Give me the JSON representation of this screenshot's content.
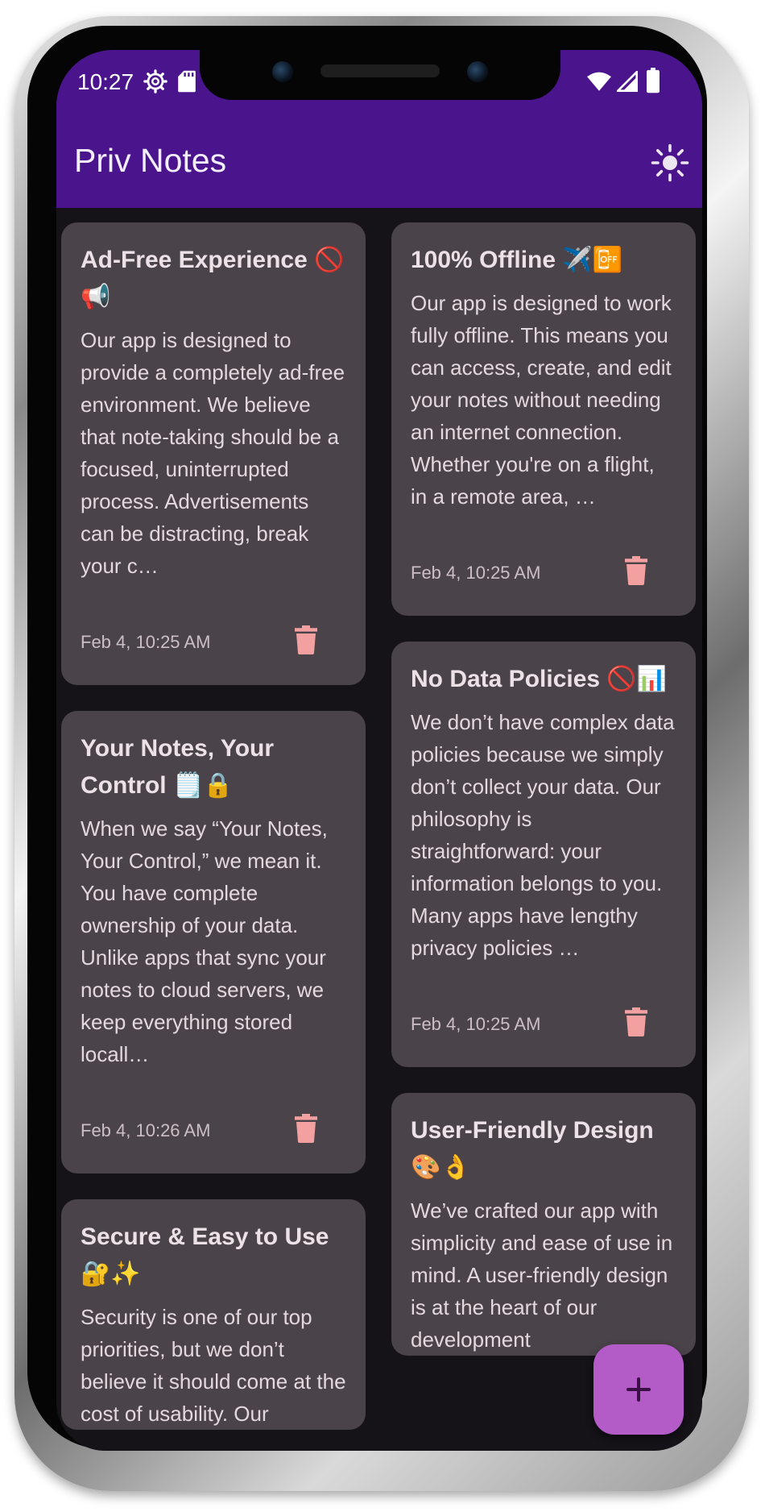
{
  "status_bar": {
    "time": "10:27",
    "icons_left": [
      "settings-icon",
      "sd-card-icon"
    ],
    "icons_right": [
      "wifi-icon",
      "signal-icon",
      "battery-icon"
    ]
  },
  "app_bar": {
    "title": "Priv Notes",
    "theme_toggle_icon": "sun-icon"
  },
  "colors": {
    "app_bar": "#4a148c",
    "background": "#151218",
    "card": "#4a4349",
    "delete_icon": "#f2a0a0",
    "fab": "#b35cc8"
  },
  "notes": {
    "left": [
      {
        "title": "Ad-Free Experience 🚫📢",
        "body": "Our app is designed to provide a completely ad-free environment. We believe that note-taking should be a focused, uninterrupted process. Advertisements can be distracting, break your c…",
        "date": "Feb 4, 10:25 AM"
      },
      {
        "title": "Your Notes, Your Control 🗒️🔒",
        "body": "When we say “Your Notes, Your Control,” we mean it. You have complete ownership of your data. Unlike apps that sync your notes to cloud servers, we keep everything stored locall…",
        "date": "Feb 4, 10:26 AM"
      },
      {
        "title": "Secure & Easy to Use 🔐✨",
        "body": "Security is one of our top priorities, but we don’t believe it should come at the cost of usability. Our",
        "date": ""
      }
    ],
    "right": [
      {
        "title": "100% Offline ✈️📴",
        "body": "Our app is designed to work fully offline. This means you can access, create, and edit your notes without needing an internet connection. Whether you're on a flight, in a remote area, …",
        "date": "Feb 4, 10:25 AM"
      },
      {
        "title": "No Data Policies 🚫📊",
        "body": "We don’t have complex data policies because we simply don’t collect your data. Our philosophy is straightforward: your information belongs to you. Many apps have lengthy privacy policies …",
        "date": "Feb 4, 10:25 AM"
      },
      {
        "title": "User-Friendly Design 🎨👌",
        "body": "We’ve crafted our app with simplicity and ease of use in mind. A user-friendly design is at the heart of our development",
        "date": ""
      }
    ]
  },
  "fab": {
    "icon": "plus-icon"
  }
}
